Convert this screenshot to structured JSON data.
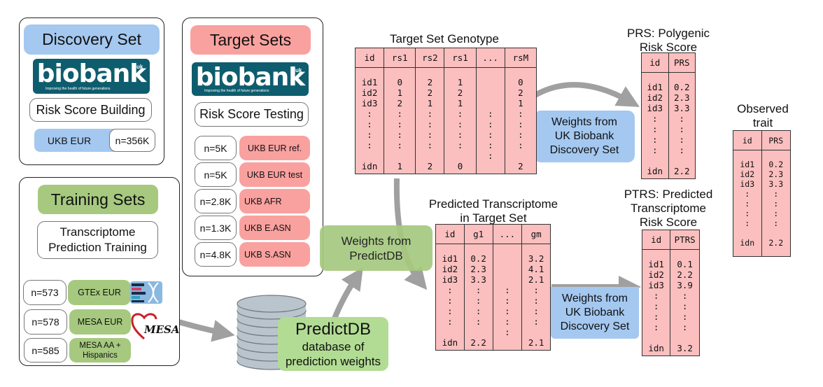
{
  "discovery": {
    "title": "Discovery Set",
    "logo_word": "biobank",
    "logo_uk": "uk",
    "logo_tagline": "Improving the health of future generations",
    "purpose": "Risk Score Building",
    "cohort_label": "UKB EUR",
    "cohort_n": "n=356K"
  },
  "target": {
    "title": "Target Sets",
    "logo_word": "biobank",
    "logo_uk": "uk",
    "logo_tagline": "Improving the health of future generations",
    "purpose": "Risk Score Testing",
    "cohorts": [
      {
        "n": "n=5K",
        "label": "UKB EUR ref."
      },
      {
        "n": "n=5K",
        "label": "UKB EUR test"
      },
      {
        "n": "n=2.8K",
        "label": "UKB AFR"
      },
      {
        "n": "n=1.3K",
        "label": "UKB E.ASN"
      },
      {
        "n": "n=4.8K",
        "label": "UKB S.ASN"
      }
    ]
  },
  "training": {
    "title": "Training Sets",
    "purpose_line1": "Transcriptome",
    "purpose_line2": "Prediction Training",
    "cohorts": [
      {
        "n": "n=573",
        "label": "GTEx EUR"
      },
      {
        "n": "n=578",
        "label": "MESA EUR"
      },
      {
        "n": "n=585",
        "label_line1": "MESA AA +",
        "label_line2": "Hispanics"
      }
    ],
    "mesa_logo_text": "MESA"
  },
  "predictdb": {
    "title": "PredictDB",
    "subtitle_line1": "database of",
    "subtitle_line2": "prediction weights"
  },
  "weights_predictdb": {
    "line1": "Weights from",
    "line2": "PredictDB"
  },
  "weights_ukb_top": {
    "line1": "Weights from",
    "line2": "UK Biobank",
    "line3": "Discovery Set"
  },
  "weights_ukb_bottom": {
    "line1": "Weights from",
    "line2": "UK Biobank",
    "line3": "Discovery Set"
  },
  "genotype_table": {
    "title": "Target Set Genotype",
    "headers": [
      "id",
      "rs1",
      "rs2",
      "rs1",
      "...",
      "rsM"
    ],
    "columns": [
      "id1\nid2\nid3\n:\n:\n:\n:\n\nidn",
      "0\n1\n2\n:\n:\n:\n:\n\n1",
      "2\n2\n1\n:\n:\n:\n:\n\n2",
      "1\n2\n1\n:\n:\n:\n:\n\n0",
      "\n\n\n:\n:\n:\n:\n:\n",
      "0\n2\n1\n:\n:\n:\n:\n\n2"
    ]
  },
  "prs_table": {
    "title_line1": "PRS: Polygenic",
    "title_line2": "Risk Score",
    "headers": [
      "id",
      "PRS"
    ],
    "columns": [
      "id1\nid2\nid3\n:\n:\n:\n:\n\nidn",
      "0.2\n2.3\n3.3\n:\n:\n:\n:\n\n2.2"
    ]
  },
  "transcriptome_table": {
    "title_line1": "Predicted Transcriptome",
    "title_line2": "in Target Set",
    "headers": [
      "id",
      "g1",
      "...",
      "gm"
    ],
    "columns": [
      "id1\nid2\nid3\n:\n:\n:\n:\n\nidn",
      "0.2\n2.3\n3.3\n:\n:\n:\n:\n\n2.2",
      "\n\n\n:\n:\n:\n:\n:\n",
      "3.2\n4.1\n2.1\n:\n:\n:\n:\n\n2.1"
    ]
  },
  "ptrs_table": {
    "title_line1": "PTRS: Predicted",
    "title_line2": "Transcriptome",
    "title_line3": "Risk Score",
    "headers": [
      "id",
      "PTRS"
    ],
    "columns": [
      "id1\nid2\nid3\n:\n:\n:\n:\n\nidn",
      "0.1\n2.2\n3.9\n:\n:\n:\n:\n\n3.2"
    ]
  },
  "observed_table": {
    "title_line1": "Observed",
    "title_line2": "trait",
    "headers": [
      "id",
      "PRS"
    ],
    "columns": [
      "id1\nid2\nid3\n:\n:\n:\n:\n\nidn",
      "0.2\n2.3\n3.3\n:\n:\n:\n:\n\n2.2"
    ]
  },
  "colors": {
    "discovery_blue": "#a4c8f0",
    "target_red": "#f9a19f",
    "training_green": "#a6c97f",
    "predictdb_green": "#b2dc93",
    "table_pink": "#fbbfbf",
    "biobank_teal": "#0e5d6e",
    "arrow_gray": "#a0a0a0"
  }
}
